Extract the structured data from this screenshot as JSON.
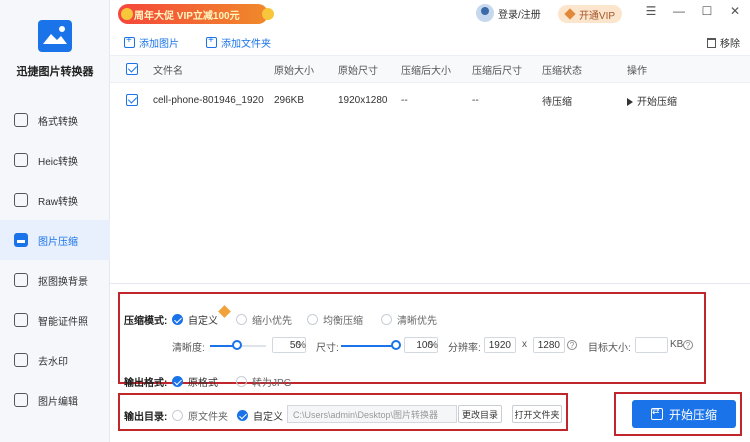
{
  "app": {
    "name": "迅捷图片转换器"
  },
  "colors": {
    "accent": "#1a73e8",
    "promo": "#f5463c",
    "highlight_box": "#c0262c"
  },
  "sidebar": {
    "items": [
      {
        "label": "格式转换",
        "icon": "format-icon"
      },
      {
        "label": "Heic转换",
        "icon": "heic-icon"
      },
      {
        "label": "Raw转换",
        "icon": "raw-icon"
      },
      {
        "label": "图片压缩",
        "icon": "compress-icon",
        "active": true
      },
      {
        "label": "抠图换背景",
        "icon": "cutout-icon"
      },
      {
        "label": "智能证件照",
        "icon": "id-photo-icon"
      },
      {
        "label": "去水印",
        "icon": "watermark-icon"
      },
      {
        "label": "图片编辑",
        "icon": "edit-icon"
      }
    ]
  },
  "topbar": {
    "promo": "周年大促 VIP立减100元",
    "login": "登录/注册",
    "vip": "开通VIP",
    "controls": [
      "☰",
      "—",
      "☐",
      "✕"
    ]
  },
  "toolbar": {
    "add_image": "添加图片",
    "add_folder": "添加文件夹",
    "remove": "移除"
  },
  "table": {
    "headers": [
      "文件名",
      "原始大小",
      "原始尺寸",
      "压缩后大小",
      "压缩后尺寸",
      "压缩状态",
      "操作"
    ],
    "rows": [
      {
        "name": "cell-phone-801946_1920",
        "size": "296KB",
        "dims": "1920x1280",
        "new_size": "--",
        "new_dims": "--",
        "status": "待压缩",
        "action": "开始压缩"
      }
    ]
  },
  "settings": {
    "mode_label": "压缩模式:",
    "modes": [
      "自定义",
      "缩小优先",
      "均衡压缩",
      "清晰优先"
    ],
    "selected_mode": "自定义",
    "clarity_label": "清晰度:",
    "clarity_value": "50",
    "clarity_fraction": 0.5,
    "pct": "%",
    "size_label": "尺寸:",
    "size_value": "100",
    "size_fraction": 1.0,
    "resolution_label": "分辨率:",
    "res_w": "1920",
    "res_x": "x",
    "res_h": "1280",
    "target_label": "目标大小:",
    "target_value": "",
    "target_unit": "KB",
    "format_label": "输出格式:",
    "formats": [
      "原格式",
      "转为JPG"
    ],
    "output_label": "输出目录:",
    "output_options": [
      "原文件夹",
      "自定义"
    ],
    "output_path": "C:\\Users\\admin\\Desktop\\图片转换器",
    "change_dir": "更改目录",
    "open_folder": "打开文件夹",
    "start": "开始压缩"
  }
}
